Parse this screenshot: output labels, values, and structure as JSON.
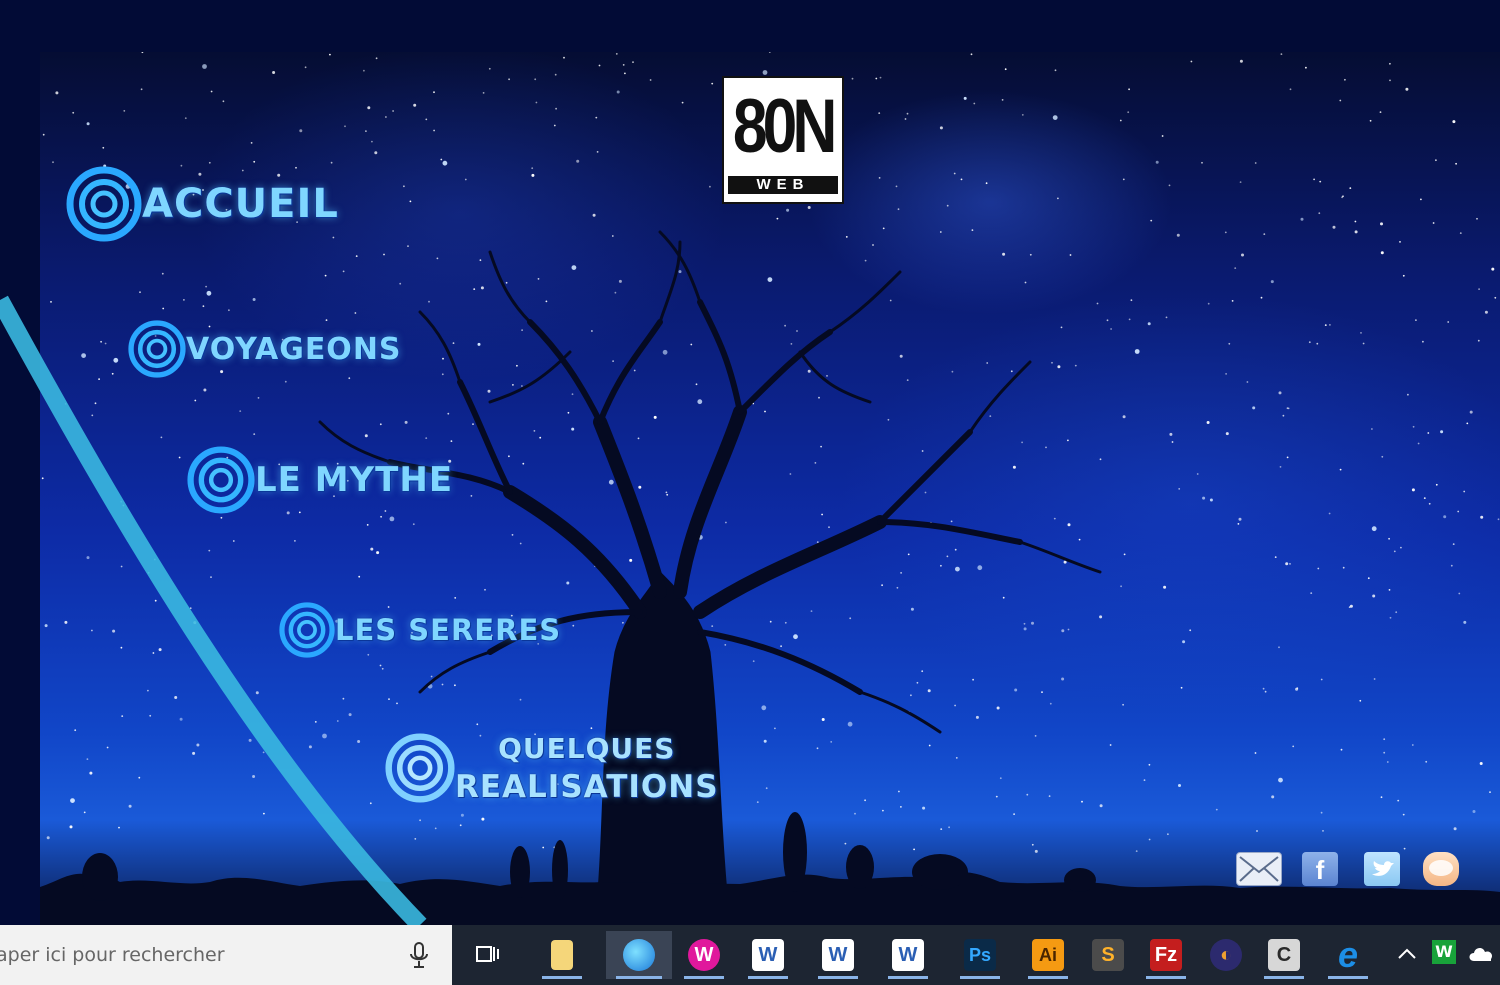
{
  "logo": {
    "main": "80N",
    "sub": "WEB"
  },
  "nav": [
    {
      "id": "accueil",
      "label": "ACCUEIL"
    },
    {
      "id": "voyageons",
      "label": "VOYAGEONS"
    },
    {
      "id": "le-mythe",
      "label": "LE MYTHE"
    },
    {
      "id": "les-sereres",
      "label": "LES SERERES"
    },
    {
      "id": "quelques-realisations",
      "line1": "QUELQUES",
      "line2": "REALISATIONS"
    }
  ],
  "social": [
    "mail-icon",
    "facebook-icon",
    "twitter-icon",
    "blog-icon"
  ],
  "taskbar": {
    "search_placeholder": "aper ici pour rechercher",
    "apps": [
      {
        "name": "task-view",
        "glyph": "⧉",
        "color": "#ffffff"
      },
      {
        "name": "file-explorer",
        "glyph": "▮",
        "color": "#f5d67a"
      },
      {
        "name": "edge",
        "glyph": "e",
        "color": "#2fb7e8"
      },
      {
        "name": "app-magenta",
        "glyph": "W",
        "color": "#e0189c"
      },
      {
        "name": "word-1",
        "glyph": "W",
        "color": "#2b5fb4"
      },
      {
        "name": "word-2",
        "glyph": "W",
        "color": "#2b5fb4"
      },
      {
        "name": "word-3",
        "glyph": "W",
        "color": "#2b5fb4"
      },
      {
        "name": "photoshop",
        "glyph": "Ps",
        "color": "#0a2a48"
      },
      {
        "name": "illustrator",
        "glyph": "Ai",
        "color": "#f59a12"
      },
      {
        "name": "sublime",
        "glyph": "S",
        "color": "#4b4b4b"
      },
      {
        "name": "filezilla",
        "glyph": "Fz",
        "color": "#c41e1e"
      },
      {
        "name": "eclipse",
        "glyph": "◐",
        "color": "#2c2a6e"
      },
      {
        "name": "terminal",
        "glyph": "C",
        "color": "#d7d7d7"
      },
      {
        "name": "internet-explorer",
        "glyph": "e",
        "color": "#1c8ee6"
      }
    ]
  }
}
